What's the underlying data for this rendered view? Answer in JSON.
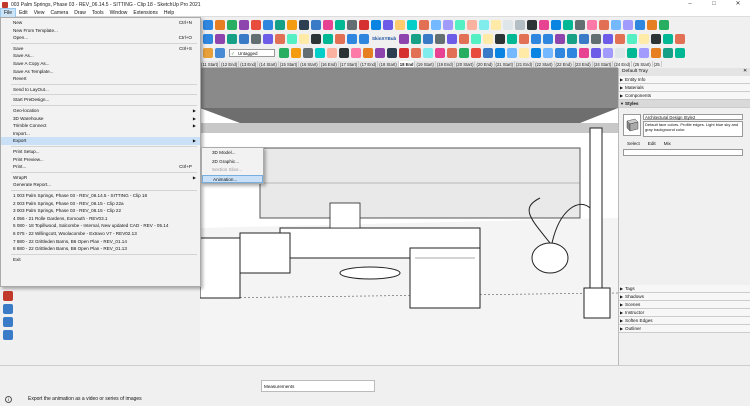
{
  "window": {
    "title": "003 Palm Springs, Phase 03 - REV_06.14.5 - SITTING - Clip 18 - SketchUp Pro 2021",
    "minimize": "–",
    "maximize": "□",
    "close": "✕"
  },
  "menubar": [
    "File",
    "Edit",
    "View",
    "Camera",
    "Draw",
    "Tools",
    "Window",
    "Extensions",
    "Help"
  ],
  "toolbar": {
    "layer_value": "Untagged",
    "skin_label": "SkinXYBub"
  },
  "scene_tabs": [
    "(11 Start)",
    "(12 End)",
    "(13 End)",
    "(14 Start)",
    "(15 Start)",
    "(16 Start)",
    "(16 End)",
    "(17 Start)",
    "(17 End)",
    "(18 Start)",
    "18 End",
    "(19 Start)",
    "(19 End)",
    "(20 Start)",
    "(20 End)",
    "(21 Start)",
    "(21 End)",
    "(22 Start)",
    "(22 End)",
    "(23 End)",
    "(24 Start)",
    "(24 End)",
    "(25 Start)",
    "(25"
  ],
  "file_menu": {
    "items": [
      {
        "label": "New",
        "shortcut": "Ctrl+N"
      },
      {
        "label": "New From Template..."
      },
      {
        "label": "Open...",
        "shortcut": "Ctrl+O"
      },
      {
        "sep": true
      },
      {
        "label": "Save",
        "shortcut": "Ctrl+S"
      },
      {
        "label": "Save As..."
      },
      {
        "label": "Save A Copy As..."
      },
      {
        "label": "Save As Template..."
      },
      {
        "label": "Revert"
      },
      {
        "sep": true
      },
      {
        "label": "Send to LayOut..."
      },
      {
        "sep": true
      },
      {
        "label": "Start PreDesign..."
      },
      {
        "sep": true
      },
      {
        "label": "Geo-location",
        "arrow": true
      },
      {
        "label": "3D Warehouse",
        "arrow": true
      },
      {
        "label": "Trimble Connect",
        "arrow": true
      },
      {
        "label": "Import..."
      },
      {
        "label": "Export",
        "arrow": true,
        "hl": true
      },
      {
        "sep": true
      },
      {
        "label": "Print Setup..."
      },
      {
        "label": "Print Preview..."
      },
      {
        "label": "Print...",
        "shortcut": "Ctrl+P"
      },
      {
        "sep": true
      },
      {
        "label": "WrapR",
        "arrow": true
      },
      {
        "label": "Generate Report..."
      },
      {
        "sep": true
      },
      {
        "label": "1 003 Palm Springs, Phase 03 - REV_06.14.5 - SITTING - Clip 18"
      },
      {
        "label": "2 003 Palm Springs, Phase 03 - REV_06.15 - Clip 22a"
      },
      {
        "label": "3 003 Palm Springs, Phase 03 - REV_06.15 - Clip 22"
      },
      {
        "label": "4 056 - 21 Rolle Gardens, Exmouth - REV03.1"
      },
      {
        "label": "5 080 - 18 Topillwood, Salcombe - Internal, New updated  CAD - REV - 05.14"
      },
      {
        "label": "6 075 - 22 Willingcott, Woolacombe - Extravo V7 - REV02.13"
      },
      {
        "label": "7 880 - 22 Grittleden Barns, B6 Open Plan - REV_01.14"
      },
      {
        "label": "8 880 - 22 Grittleden Barns, B6 Open Plan - REV_01.13"
      },
      {
        "sep": true
      },
      {
        "label": "Exit"
      }
    ]
  },
  "export_submenu": [
    {
      "label": "3D Model..."
    },
    {
      "label": "2D Graphic..."
    },
    {
      "label": "Section Slice...",
      "disabled": true
    },
    {
      "label": "Animation...",
      "hl": true
    }
  ],
  "tray": {
    "title": "Default Tray",
    "top_sections": [
      "Entity Info",
      "Materials",
      "Components",
      "Styles"
    ],
    "style_name": "Architectural Design Style2",
    "style_desc": "Default face colors. Profile edges. Light blue sky and gray background color.",
    "tabs": [
      "Select",
      "Edit",
      "Mix"
    ],
    "bottom_sections": [
      "Tags",
      "Shadows",
      "Scenes",
      "Instructor",
      "Soften Edges",
      "Outliner"
    ]
  },
  "status": {
    "measurements_label": "Measurements",
    "message": "Export the animation as a video or series of images"
  }
}
